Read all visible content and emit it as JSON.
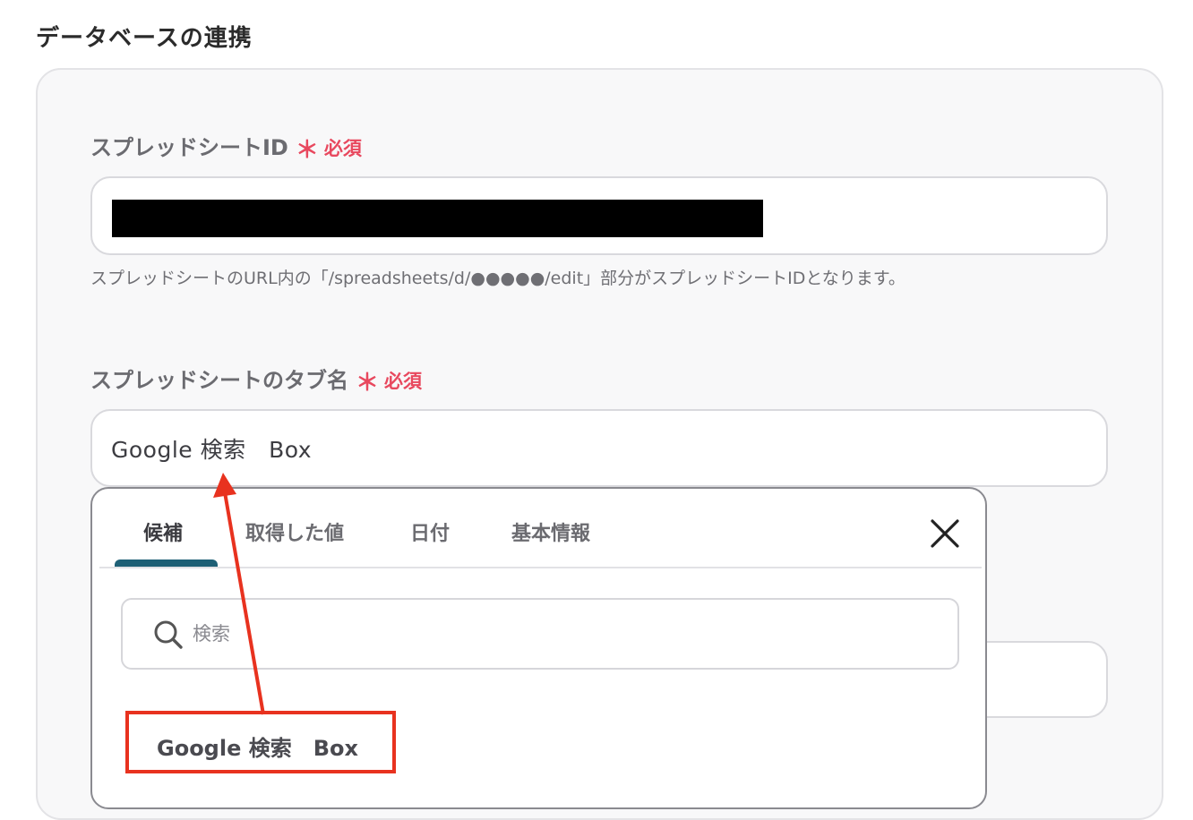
{
  "section": {
    "title": "データベースの連携"
  },
  "fields": {
    "spreadsheet_id": {
      "label": "スプレッドシートID",
      "required_star": "＊",
      "required_text": "必須",
      "help_text": "スプレッドシートのURL内の「/spreadsheets/d/●●●●●/edit」部分がスプレッドシートIDとなります。"
    },
    "tab_name": {
      "label": "スプレッドシートのタブ名",
      "required_star": "＊",
      "required_text": "必須",
      "value": "Google 検索　Box"
    }
  },
  "popover": {
    "tabs": [
      {
        "label": "候補",
        "active": true
      },
      {
        "label": "取得した値",
        "active": false
      },
      {
        "label": "日付",
        "active": false
      },
      {
        "label": "基本情報",
        "active": false
      }
    ],
    "search": {
      "placeholder": "検索"
    },
    "suggestions": [
      {
        "label": "Google 検索　Box"
      }
    ]
  },
  "icons": {
    "close": "close-icon",
    "search": "search-icon"
  },
  "colors": {
    "required": "#e8485e",
    "active_tab_indicator": "#1e6076",
    "annotation": "#e8321f"
  }
}
